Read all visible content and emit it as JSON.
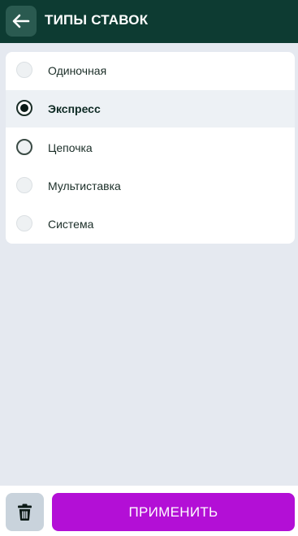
{
  "header": {
    "title": "ТИПЫ СТАВОК"
  },
  "options": [
    {
      "label": "Одиночная",
      "state": "unchecked"
    },
    {
      "label": "Экспресс",
      "state": "checked"
    },
    {
      "label": "Цепочка",
      "state": "outlined"
    },
    {
      "label": "Мультиставка",
      "state": "unchecked"
    },
    {
      "label": "Система",
      "state": "unchecked"
    }
  ],
  "footer": {
    "apply_label": "ПРИМЕНИТЬ"
  },
  "colors": {
    "header_bg": "#0d3b32",
    "apply_button": "#b30fd6",
    "page_bg": "#e5e9f0"
  },
  "icons": {
    "back": "arrow-left-icon",
    "delete": "trash-icon"
  }
}
